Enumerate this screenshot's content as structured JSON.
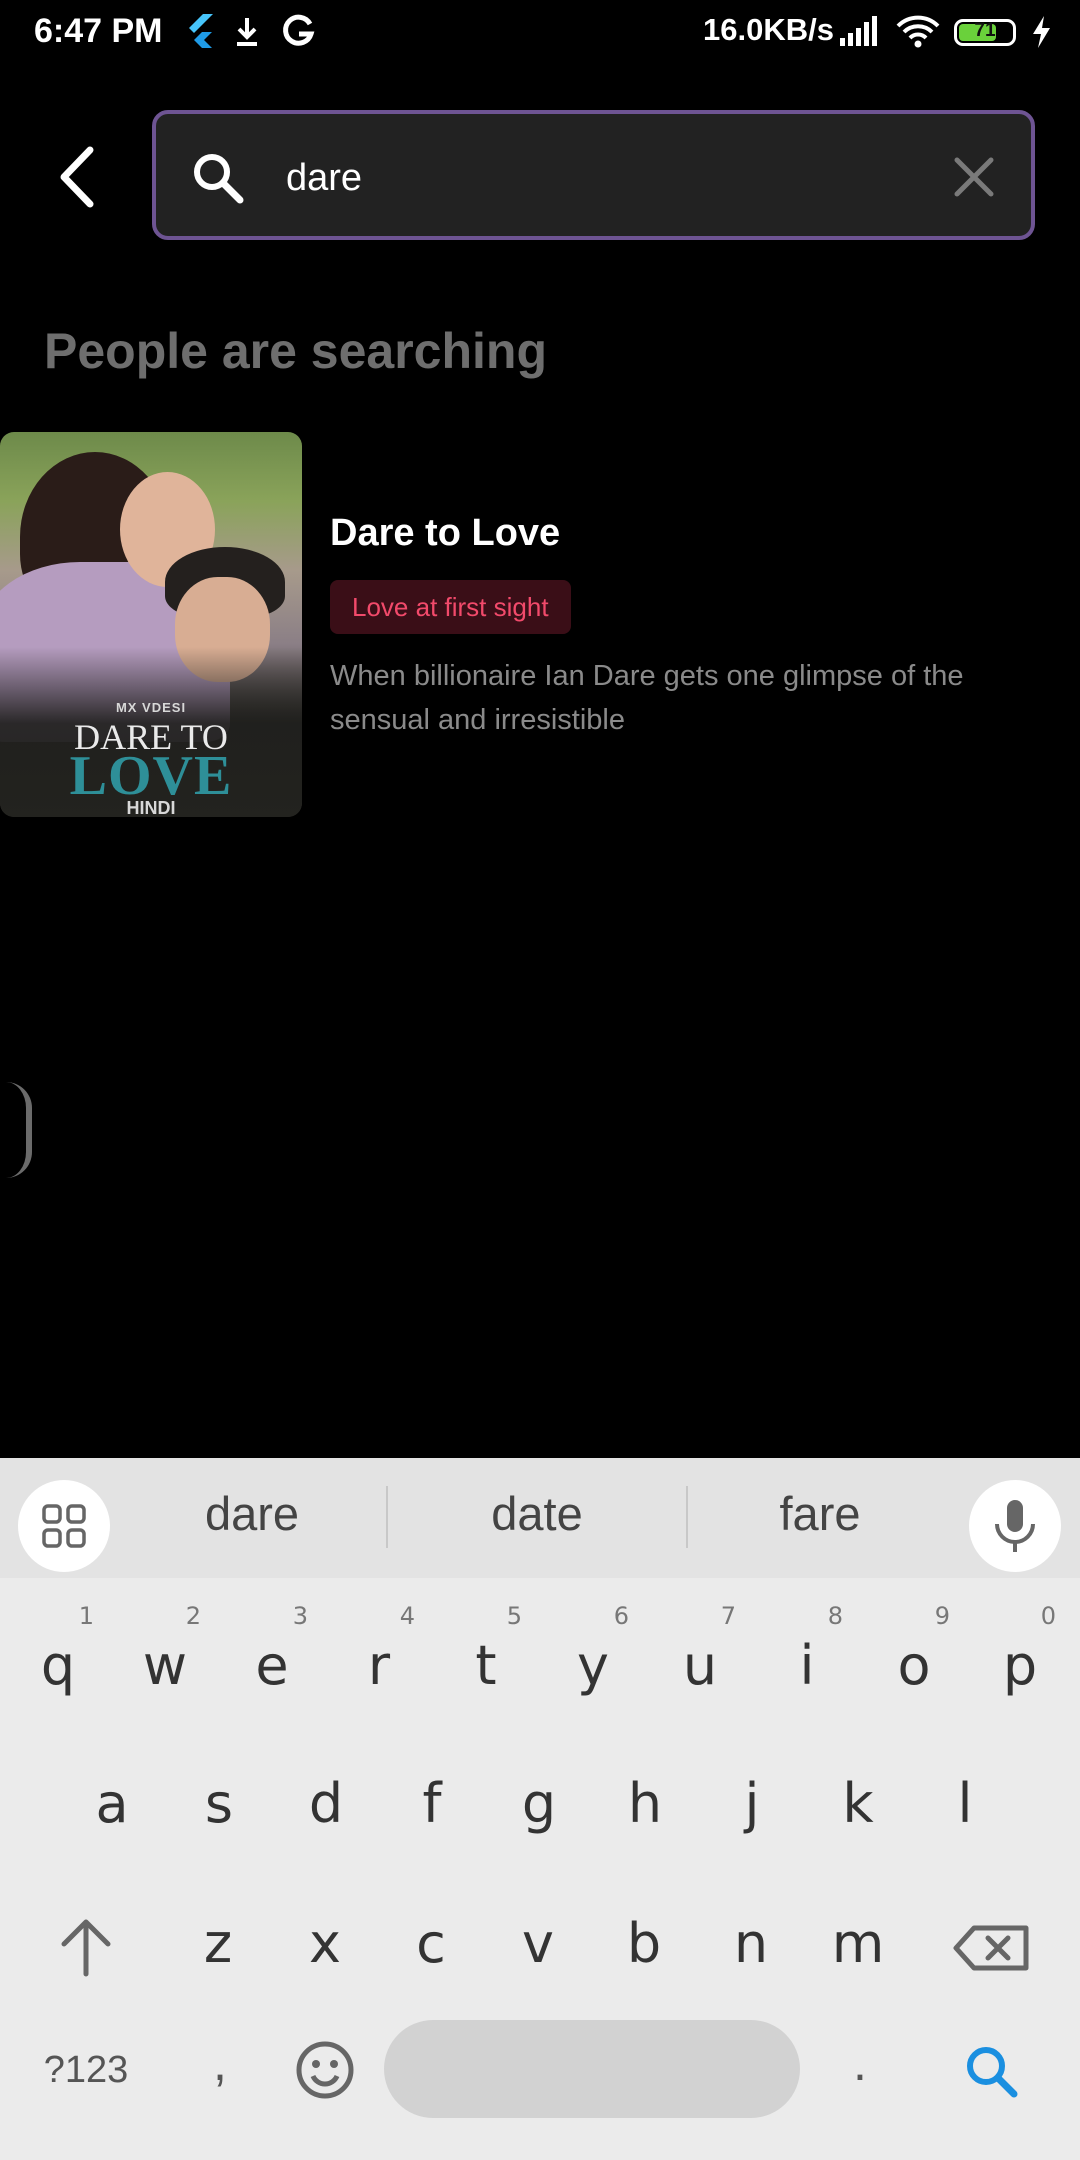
{
  "status_bar": {
    "time": "6:47 PM",
    "network_speed": "16.0KB/s",
    "battery_level": "71",
    "battery_fraction": 0.71,
    "icons": [
      "flutter-icon",
      "download-icon",
      "google-icon",
      "signal-icon",
      "wifi-icon",
      "battery-icon",
      "charging-icon"
    ],
    "battery_color": "#6ad13b"
  },
  "header": {
    "back_icon": "chevron-left-icon",
    "search": {
      "value": "dare",
      "icon": "search-icon",
      "clear_icon": "close-icon",
      "border_color": "#6e5493"
    }
  },
  "section": {
    "title": "People are searching"
  },
  "results": [
    {
      "title": "Dare to Love",
      "tag": "Love at first sight",
      "description": "When billionaire Ian Dare gets one glimpse of the sensual and irresistible",
      "poster": {
        "brand": "MX VDESI",
        "title_top": "DARE TO",
        "title_bottom": "LOVE",
        "language": "HINDI"
      },
      "tag_color": "#f24a6b"
    }
  ],
  "keyboard": {
    "suggestions": [
      "dare",
      "date",
      "fare"
    ],
    "apps_icon": "apps-grid-icon",
    "mic_icon": "microphone-icon",
    "row1": [
      {
        "key": "q",
        "hint": "1"
      },
      {
        "key": "w",
        "hint": "2"
      },
      {
        "key": "e",
        "hint": "3"
      },
      {
        "key": "r",
        "hint": "4"
      },
      {
        "key": "t",
        "hint": "5"
      },
      {
        "key": "y",
        "hint": "6"
      },
      {
        "key": "u",
        "hint": "7"
      },
      {
        "key": "i",
        "hint": "8"
      },
      {
        "key": "o",
        "hint": "9"
      },
      {
        "key": "p",
        "hint": "0"
      }
    ],
    "row2": [
      "a",
      "s",
      "d",
      "f",
      "g",
      "h",
      "j",
      "k",
      "l"
    ],
    "row3": [
      "z",
      "x",
      "c",
      "v",
      "b",
      "n",
      "m"
    ],
    "shift_icon": "shift-arrow-icon",
    "backspace_icon": "backspace-icon",
    "symbols_label": "?123",
    "comma": ",",
    "emoji_icon": "emoji-icon",
    "period": ".",
    "action_icon": "search-icon",
    "action_color": "#1a8fe0"
  }
}
